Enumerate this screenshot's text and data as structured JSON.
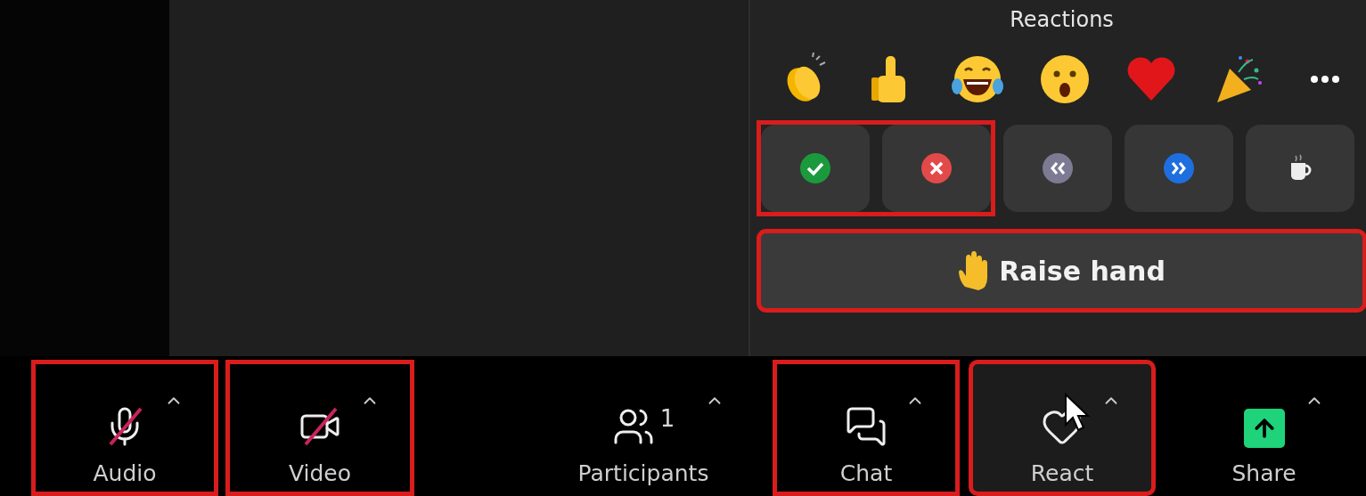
{
  "reactions": {
    "title": "Reactions",
    "emojis": [
      {
        "kind": "clap"
      },
      {
        "kind": "thumbs_up"
      },
      {
        "kind": "laugh"
      },
      {
        "kind": "surprised"
      },
      {
        "kind": "heart"
      },
      {
        "kind": "party"
      },
      {
        "kind": "more"
      }
    ],
    "status_buttons": [
      {
        "kind": "yes",
        "highlighted": true
      },
      {
        "kind": "no",
        "highlighted": true
      },
      {
        "kind": "slower",
        "highlighted": false
      },
      {
        "kind": "faster",
        "highlighted": false
      },
      {
        "kind": "coffee",
        "highlighted": false
      }
    ],
    "raise_hand": {
      "label": "Raise hand",
      "highlighted": true
    }
  },
  "toolbar": [
    {
      "kind": "audio",
      "label": "Audio",
      "off": true,
      "highlighted": true,
      "selected": false
    },
    {
      "kind": "video",
      "label": "Video",
      "off": true,
      "highlighted": true,
      "selected": false
    },
    {
      "kind": "participants",
      "label": "Participants",
      "count": "1",
      "highlighted": false,
      "selected": false
    },
    {
      "kind": "chat",
      "label": "Chat",
      "highlighted": true,
      "selected": false
    },
    {
      "kind": "react",
      "label": "React",
      "highlighted": true,
      "selected": true
    },
    {
      "kind": "share",
      "label": "Share",
      "highlighted": false,
      "selected": false
    }
  ]
}
